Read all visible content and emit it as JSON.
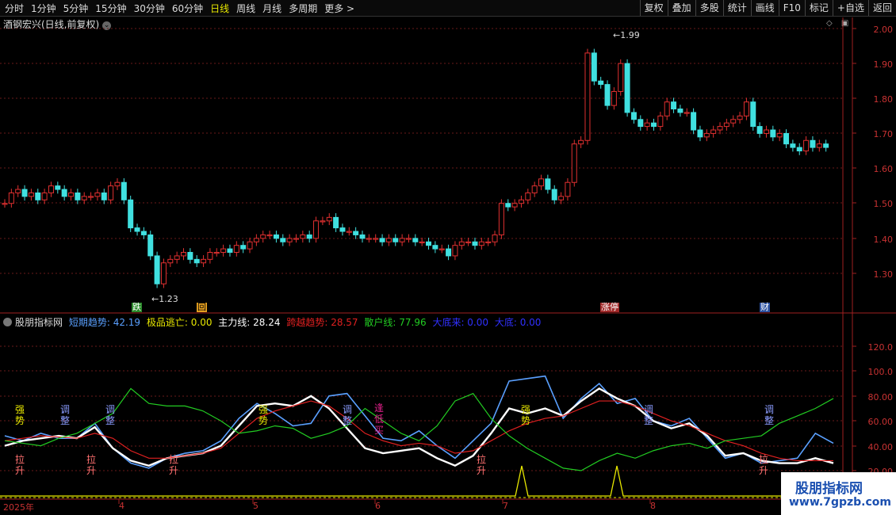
{
  "toolbar": {
    "tabs": [
      "分时",
      "1分钟",
      "5分钟",
      "15分钟",
      "30分钟",
      "60分钟",
      "日线",
      "周线",
      "月线",
      "多周期",
      "更多 >"
    ],
    "active_tab": "日线",
    "buttons": [
      "复权",
      "叠加",
      "多股",
      "统计",
      "画线",
      "F10",
      "标记",
      "+自选",
      "返回"
    ]
  },
  "stock": {
    "title": "酒钢宏兴(日线,前复权)"
  },
  "main_chart": {
    "price_axis": [
      "2.00",
      "1.90",
      "1.80",
      "1.70",
      "1.60",
      "1.50",
      "1.40",
      "1.30"
    ],
    "high_label": "1.99",
    "low_label": "1.23",
    "badges": [
      {
        "text": "跌",
        "color": "#2fbf2f"
      },
      {
        "text": "回",
        "color": "#e6a020"
      },
      {
        "text": "涨停",
        "color": "#d84a4a"
      },
      {
        "text": "财",
        "color": "#4a7ad8"
      }
    ]
  },
  "indicator": {
    "name": "股朋指标网",
    "items": [
      {
        "label": "短期趋势: 42.19",
        "color": "#5aa0ff"
      },
      {
        "label": "极品逃亡: 0.00",
        "color": "#e8e800"
      },
      {
        "label": "主力线: 28.24",
        "color": "#ffffff"
      },
      {
        "label": "跨越趋势: 28.57",
        "color": "#e02020"
      },
      {
        "label": "散户线: 77.96",
        "color": "#22cc22"
      },
      {
        "label": "大底来: 0.00",
        "color": "#3030ff"
      },
      {
        "label": "大底: 0.00",
        "color": "#3030ff"
      }
    ],
    "axis": [
      "120.0",
      "100.0",
      "80.00",
      "60.00",
      "40.00",
      "20.00"
    ],
    "labels": [
      {
        "text": "强势",
        "color": "#e8e800"
      },
      {
        "text": "调整",
        "color": "#8a9cff"
      },
      {
        "text": "调整",
        "color": "#8a9cff"
      },
      {
        "text": "强势",
        "color": "#e8e800"
      },
      {
        "text": "调整",
        "color": "#8a9cff"
      },
      {
        "text": "逢低买",
        "color": "#e0208a"
      },
      {
        "text": "强势",
        "color": "#e8e800"
      },
      {
        "text": "调整",
        "color": "#8a9cff"
      },
      {
        "text": "调整",
        "color": "#8a9cff"
      },
      {
        "text": "拉升",
        "color": "#ff7070"
      },
      {
        "text": "拉升",
        "color": "#ff7070"
      },
      {
        "text": "拉升",
        "color": "#ff7070"
      },
      {
        "text": "拉升",
        "color": "#ff7070"
      },
      {
        "text": "拉升",
        "color": "#ff7070"
      }
    ]
  },
  "x_axis": [
    "2025年",
    "4",
    "5",
    "6",
    "7",
    "8"
  ],
  "watermark": {
    "line1": "股朋指标网",
    "line2": "www.7gpzb.com"
  }
}
